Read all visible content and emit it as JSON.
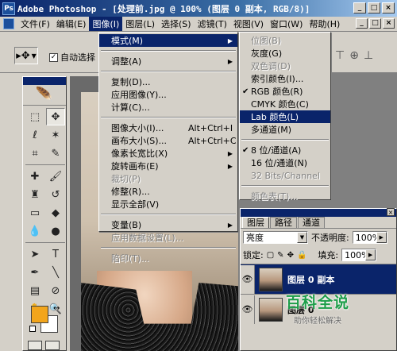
{
  "window": {
    "app_icon_label": "Ps",
    "title": "Adobe Photoshop - [处理前.jpg @ 100% (图层 0 副本, RGB/8)]",
    "buttons": [
      "_",
      "□",
      "×"
    ]
  },
  "menubar": {
    "items": [
      "文件(F)",
      "编辑(E)",
      "图像(I)",
      "图层(L)",
      "选择(S)",
      "滤镜(T)",
      "视图(V)",
      "窗口(W)",
      "帮助(H)"
    ],
    "active_index": 2,
    "mdi_buttons": [
      "_",
      "□",
      "×"
    ]
  },
  "options": {
    "tool_glyph": "▸✥",
    "auto_select_label": "自动选择",
    "auto_select_checked": "✓"
  },
  "image_menu": [
    {
      "label": "模式(M)",
      "submenu": true,
      "highlight": true
    },
    {
      "sep": true
    },
    {
      "label": "调整(A)",
      "submenu": true
    },
    {
      "sep": true
    },
    {
      "label": "复制(D)..."
    },
    {
      "label": "应用图像(Y)..."
    },
    {
      "label": "计算(C)..."
    },
    {
      "sep": true
    },
    {
      "label": "图像大小(I)...",
      "shortcut": "Alt+Ctrl+I"
    },
    {
      "label": "画布大小(S)...",
      "shortcut": "Alt+Ctrl+C"
    },
    {
      "label": "像素长宽比(X)",
      "submenu": true
    },
    {
      "label": "旋转画布(E)",
      "submenu": true
    },
    {
      "label": "裁切(P)",
      "disabled": true
    },
    {
      "label": "修整(R)..."
    },
    {
      "label": "显示全部(V)"
    },
    {
      "sep": true
    },
    {
      "label": "变量(B)",
      "submenu": true
    },
    {
      "label": "应用数据设置(L)...",
      "disabled": true
    },
    {
      "sep": true
    },
    {
      "label": "陷印(T)...",
      "disabled": true
    }
  ],
  "mode_submenu": [
    {
      "label": "位图(B)",
      "disabled": true
    },
    {
      "label": "灰度(G)"
    },
    {
      "label": "双色调(D)",
      "disabled": true
    },
    {
      "label": "索引颜色(I)..."
    },
    {
      "label": "RGB 颜色(R)",
      "checked": true
    },
    {
      "label": "CMYK 颜色(C)"
    },
    {
      "label": "Lab 颜色(L)",
      "highlight": true
    },
    {
      "label": "多通道(M)"
    },
    {
      "sep": true
    },
    {
      "label": "8 位/通道(A)",
      "checked": true
    },
    {
      "label": "16 位/通道(N)"
    },
    {
      "label": "32 Bits/Channel",
      "disabled": true
    },
    {
      "sep": true
    },
    {
      "label": "颜色表(T)...",
      "disabled": true
    }
  ],
  "layers_panel": {
    "tabs": [
      "图层",
      "路径",
      "通道"
    ],
    "active_tab": 0,
    "blend_mode": "亮度",
    "opacity_label": "不透明度:",
    "opacity_value": "100%",
    "lock_label": "锁定:",
    "fill_label": "填充:",
    "fill_value": "100%",
    "layers": [
      {
        "name": "图层 0 副本",
        "selected": true
      },
      {
        "name": "图层 0",
        "selected": false
      }
    ]
  },
  "colors": {
    "foreground": "#f2a51c",
    "background": "#ffffff",
    "highlight": "#0a246a"
  },
  "watermark": {
    "title": "百科全说",
    "subtitle": "助你轻松解决"
  }
}
